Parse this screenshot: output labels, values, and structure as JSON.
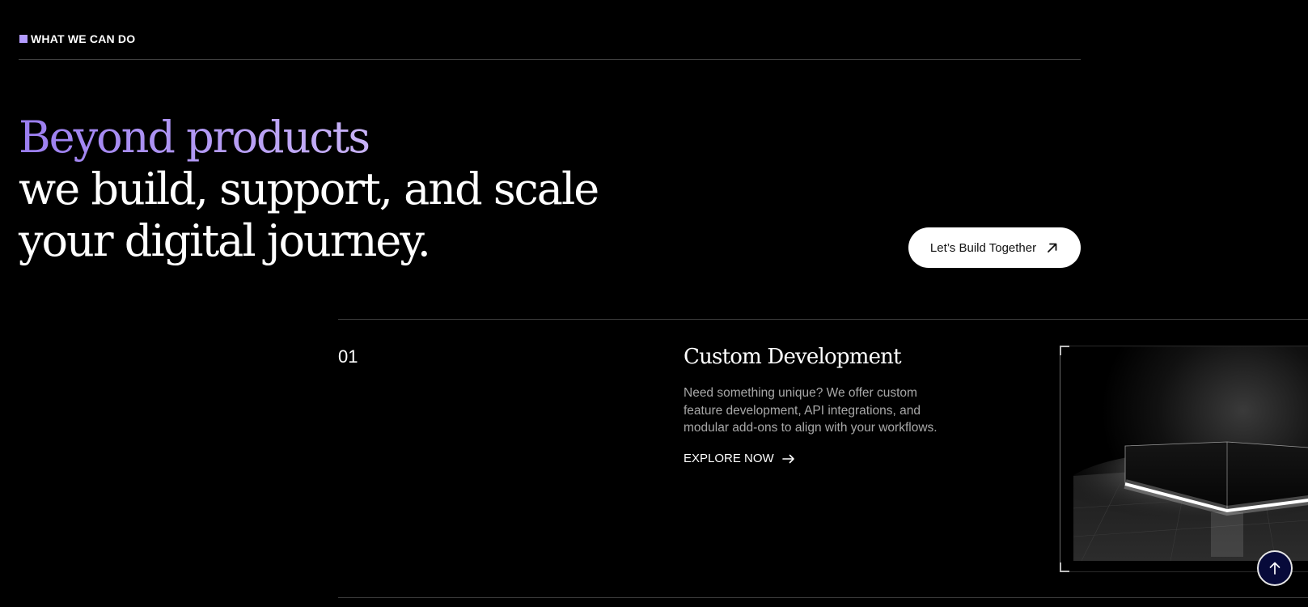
{
  "section": {
    "label": "WHAT WE CAN DO"
  },
  "hero": {
    "headline_accent": "Beyond products",
    "headline_line2": "we build, support, and scale",
    "headline_line3": "your digital journey.",
    "cta_label": "Let’s Build Together"
  },
  "services": [
    {
      "number": "01",
      "title": "Custom Development",
      "description": "Need something unique? We offer custom feature development, API integrations, and modular add-ons to align with your workflows.",
      "link_label": "EXPLORE NOW"
    }
  ],
  "icons": {
    "section_marker": "square-marker-icon",
    "cta": "arrow-up-right-icon",
    "explore": "arrow-right-icon",
    "scroll_top": "arrow-up-icon"
  },
  "colors": {
    "background": "#000000",
    "accent": "#b39bff",
    "text_primary": "#ffffff",
    "text_muted": "#a8a8a8",
    "scroll_button_bg": "#070a3a"
  }
}
